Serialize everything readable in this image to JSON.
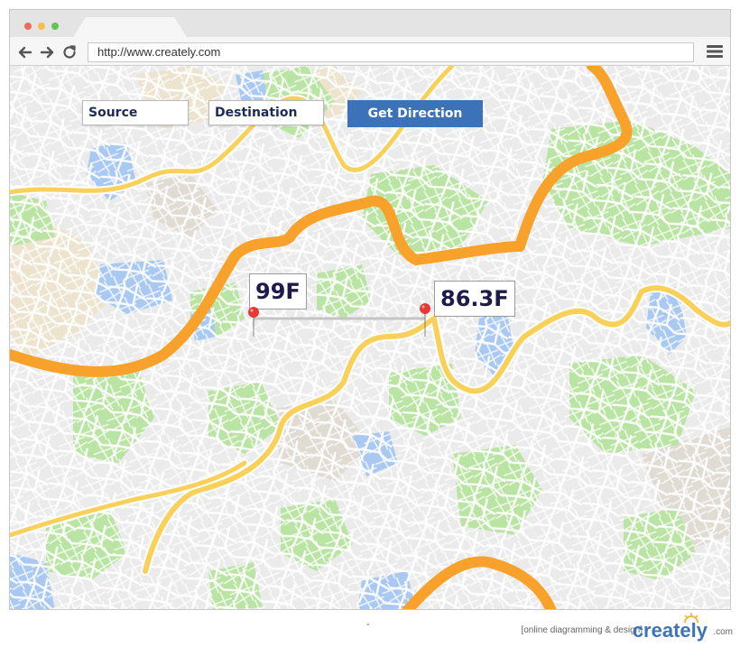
{
  "browser": {
    "url": "http://www.creately.com"
  },
  "map": {
    "inputs": {
      "source": "Source",
      "destination": "Destination"
    },
    "get_direction_label": "Get Direction",
    "markers": [
      {
        "temperature": "99F"
      },
      {
        "temperature": "86.3F"
      }
    ],
    "colors": {
      "highway": "#f7a02a",
      "road": "#f8d25c",
      "park": "#b8e3a0",
      "water": "#a7c9f4",
      "land": "#ece7d8",
      "pin": "#e53935"
    }
  },
  "footer": {
    "separator": "-",
    "tagline": "[online diagramming & design]",
    "brand": "creately",
    "domain": ".com"
  }
}
